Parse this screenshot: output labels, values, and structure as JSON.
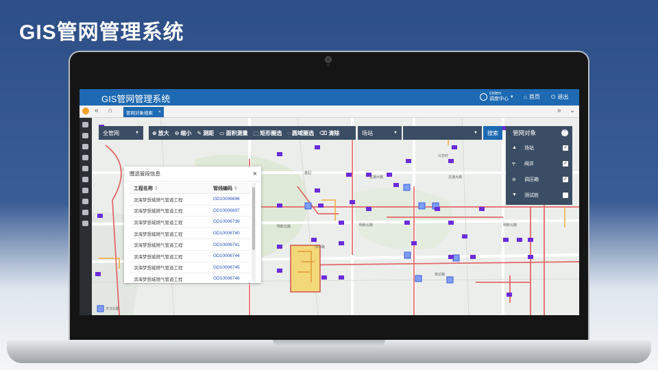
{
  "slide": {
    "title": "GIS管网管理系统"
  },
  "app": {
    "title": "GIS管网管理系统",
    "user": {
      "name": "cnten",
      "role": "调度中心"
    },
    "home_label": "首页",
    "logout_label": "退出"
  },
  "tabs": [
    {
      "label": "管网对象搜索"
    }
  ],
  "toolbar": {
    "network_select": "全管网",
    "tools": [
      {
        "icon": "zoom-in-icon",
        "label": "放大"
      },
      {
        "icon": "zoom-out-icon",
        "label": "缩小"
      },
      {
        "icon": "ruler-icon",
        "label": "测距"
      },
      {
        "icon": "area-icon",
        "label": "面积测量"
      },
      {
        "icon": "rect-select-icon",
        "label": "矩形圈选"
      },
      {
        "icon": "circle-select-icon",
        "label": "圆域圈选"
      },
      {
        "icon": "eraser-icon",
        "label": "清除"
      }
    ],
    "station_select": "场站",
    "search_button": "搜索"
  },
  "layer_panel": {
    "title": "管网对象",
    "items": [
      {
        "icon": "station-icon",
        "label": "场站",
        "checked": true
      },
      {
        "icon": "valve-icon",
        "label": "阀井",
        "checked": true
      },
      {
        "icon": "regulator-icon",
        "label": "调压箱",
        "checked": true
      },
      {
        "icon": "test-pile-icon",
        "label": "测试桩",
        "checked": false
      }
    ]
  },
  "popup": {
    "title": "圈选管段信息",
    "columns": [
      "工程名称",
      "管线编码"
    ],
    "rows": [
      [
        "滨海梦想城燃气管道工程",
        "GD10006696"
      ],
      [
        "滨海梦想城燃气管道工程",
        "GD10006697"
      ],
      [
        "滨海梦想城燃气管道工程",
        "GD10006739"
      ],
      [
        "滨海梦想城燃气管道工程",
        "GD10006740"
      ],
      [
        "滨海梦想城燃气管道工程",
        "GD10006741"
      ],
      [
        "滨海梦想城燃气管道工程",
        "GD10006744"
      ],
      [
        "滨海梦想城燃气管道工程",
        "GD10006745"
      ],
      [
        "滨海梦想城燃气管道工程",
        "GD10006746"
      ]
    ]
  },
  "map_labels": [
    "龙湖大路",
    "龙湖大路",
    "明新北路",
    "明新北路",
    "明新北路",
    "景达路",
    "兴华时",
    "冰中路",
    "天汉北路",
    "鑫园"
  ],
  "colors": {
    "header": "#1d69b2",
    "toolbar": "#3b4d64",
    "pipe": "#e05a5a",
    "valve": "#6a2bd8",
    "station": "#4a6fe0",
    "sidebar": "#2b2e33"
  }
}
